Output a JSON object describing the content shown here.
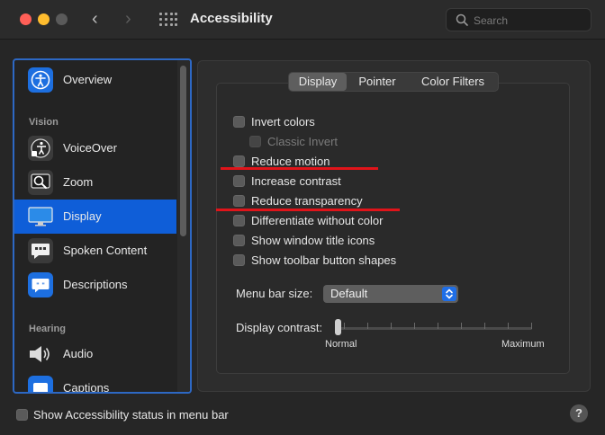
{
  "window": {
    "title": "Accessibility",
    "search_placeholder": "Search",
    "nav_back": "‹",
    "nav_forward": "›"
  },
  "sidebar": {
    "sections": {
      "vision": "Vision",
      "hearing": "Hearing"
    },
    "items": [
      {
        "label": "Overview",
        "icon": "overview-icon",
        "selected": false
      },
      {
        "label": "VoiceOver",
        "icon": "voiceover-icon",
        "selected": false
      },
      {
        "label": "Zoom",
        "icon": "zoom-icon",
        "selected": false
      },
      {
        "label": "Display",
        "icon": "display-icon",
        "selected": true
      },
      {
        "label": "Spoken Content",
        "icon": "spoken-content-icon",
        "selected": false
      },
      {
        "label": "Descriptions",
        "icon": "descriptions-icon",
        "selected": false
      },
      {
        "label": "Audio",
        "icon": "audio-icon",
        "selected": false
      },
      {
        "label": "Captions",
        "icon": "captions-icon",
        "selected": false
      }
    ]
  },
  "tabs": [
    {
      "label": "Display",
      "active": true
    },
    {
      "label": "Pointer",
      "active": false
    },
    {
      "label": "Color Filters",
      "active": false
    }
  ],
  "options": [
    {
      "label": "Invert colors",
      "checked": false,
      "disabled": false
    },
    {
      "label": "Classic Invert",
      "checked": false,
      "disabled": true
    },
    {
      "label": "Reduce motion",
      "checked": false,
      "disabled": false
    },
    {
      "label": "Increase contrast",
      "checked": false,
      "disabled": false
    },
    {
      "label": "Reduce transparency",
      "checked": false,
      "disabled": false
    },
    {
      "label": "Differentiate without color",
      "checked": false,
      "disabled": false
    },
    {
      "label": "Show window title icons",
      "checked": false,
      "disabled": false
    },
    {
      "label": "Show toolbar button shapes",
      "checked": false,
      "disabled": false
    }
  ],
  "menu_bar_size": {
    "label": "Menu bar size:",
    "value": "Default"
  },
  "display_contrast": {
    "label": "Display contrast:",
    "min_label": "Normal",
    "max_label": "Maximum",
    "value": 0
  },
  "footer": {
    "status_checkbox_label": "Show Accessibility status in menu bar",
    "help_label": "?"
  },
  "colors": {
    "accent": "#0f5ed8",
    "annotation_red": "#e0141a"
  }
}
